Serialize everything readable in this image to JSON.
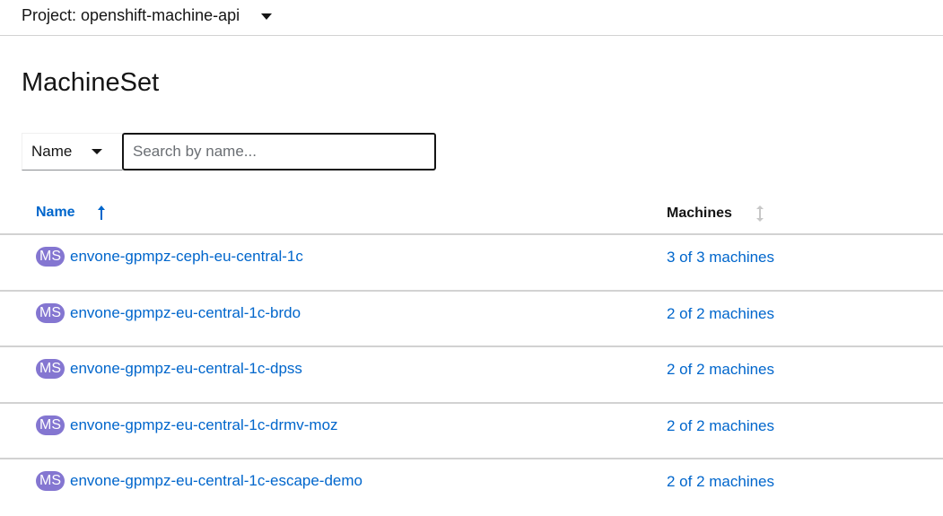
{
  "project": {
    "label": "Project: openshift-machine-api"
  },
  "page": {
    "title": "MachineSet"
  },
  "filter": {
    "type_label": "Name",
    "search_placeholder": "Search by name..."
  },
  "table": {
    "columns": {
      "name": "Name",
      "machines": "Machines"
    },
    "badge": "MS",
    "rows": [
      {
        "name": "envone-gpmpz-ceph-eu-central-1c",
        "machines": "3 of 3 machines"
      },
      {
        "name": "envone-gpmpz-eu-central-1c-brdo",
        "machines": "2 of 2 machines"
      },
      {
        "name": "envone-gpmpz-eu-central-1c-dpss",
        "machines": "2 of 2 machines"
      },
      {
        "name": "envone-gpmpz-eu-central-1c-drmv-moz",
        "machines": "2 of 2 machines"
      },
      {
        "name": "envone-gpmpz-eu-central-1c-escape-demo",
        "machines": "2 of 2 machines"
      }
    ]
  },
  "colors": {
    "link": "#0066cc",
    "badge_bg": "#8476d1",
    "divider": "#d2d2d2"
  },
  "icons": {
    "project_caret": "caret-down-icon",
    "filter_caret": "caret-down-icon",
    "name_sort": "sort-ascending-icon",
    "machines_sort": "sort-icon"
  }
}
